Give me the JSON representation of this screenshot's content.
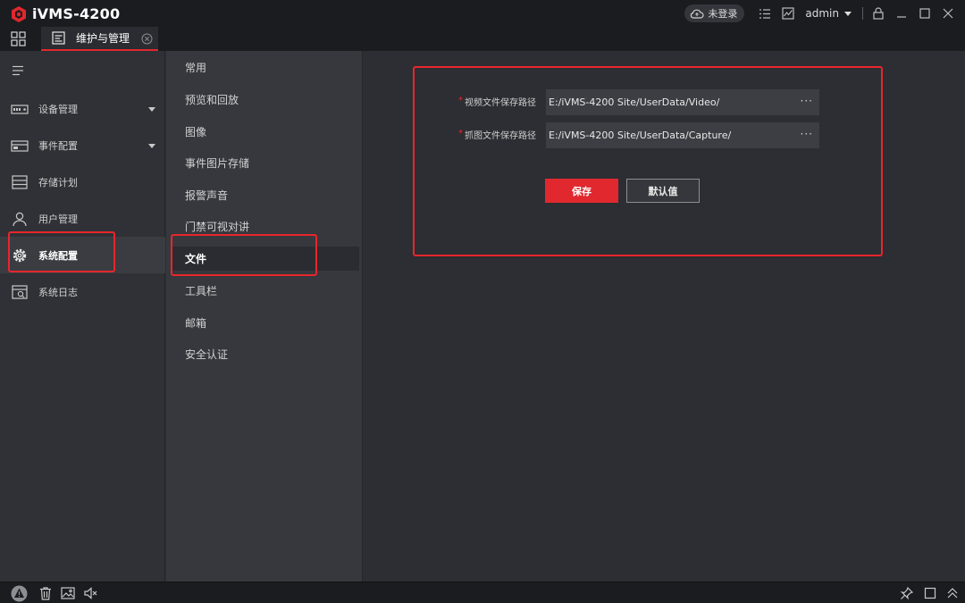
{
  "app": {
    "title": "iVMS-4200",
    "brand_color": "#e0282e"
  },
  "titlebar": {
    "cloud_status": "未登录",
    "user": "admin",
    "icons": [
      "cloud-icon",
      "list-icon",
      "monitor-icon",
      "user-dropdown-icon",
      "lock-icon",
      "minimize-icon",
      "maximize-icon",
      "close-icon"
    ]
  },
  "tabs": [
    {
      "label": "维护与管理",
      "icon": "maintenance-icon",
      "active": true
    }
  ],
  "sidebar": {
    "items": [
      {
        "label": "设备管理",
        "icon": "device-icon",
        "expandable": true
      },
      {
        "label": "事件配置",
        "icon": "event-icon",
        "expandable": true
      },
      {
        "label": "存储计划",
        "icon": "storage-icon",
        "expandable": false
      },
      {
        "label": "用户管理",
        "icon": "user-icon",
        "expandable": false
      },
      {
        "label": "系统配置",
        "icon": "gear-icon",
        "expandable": false,
        "active": true
      },
      {
        "label": "系统日志",
        "icon": "log-icon",
        "expandable": false
      }
    ]
  },
  "submenu": {
    "items": [
      {
        "label": "常用"
      },
      {
        "label": "预览和回放"
      },
      {
        "label": "图像"
      },
      {
        "label": "事件图片存储"
      },
      {
        "label": "报警声音"
      },
      {
        "label": "门禁可视对讲"
      },
      {
        "label": "文件",
        "active": true
      },
      {
        "label": "工具栏"
      },
      {
        "label": "邮箱"
      },
      {
        "label": "安全认证"
      }
    ]
  },
  "form": {
    "video_path": {
      "required_mark": "*",
      "label": "视频文件保存路径",
      "value": "E:/iVMS-4200 Site/UserData/Video/",
      "browse": "···"
    },
    "capture_path": {
      "required_mark": "*",
      "label": "抓图文件保存路径",
      "value": "E:/iVMS-4200 Site/UserData/Capture/",
      "browse": "···"
    },
    "save_label": "保存",
    "default_label": "默认值"
  },
  "statusbar": {
    "icons": [
      "warning-icon",
      "trash-icon",
      "image-icon",
      "mute-icon",
      "pin-icon",
      "window-icon",
      "collapse-up-icon"
    ]
  }
}
